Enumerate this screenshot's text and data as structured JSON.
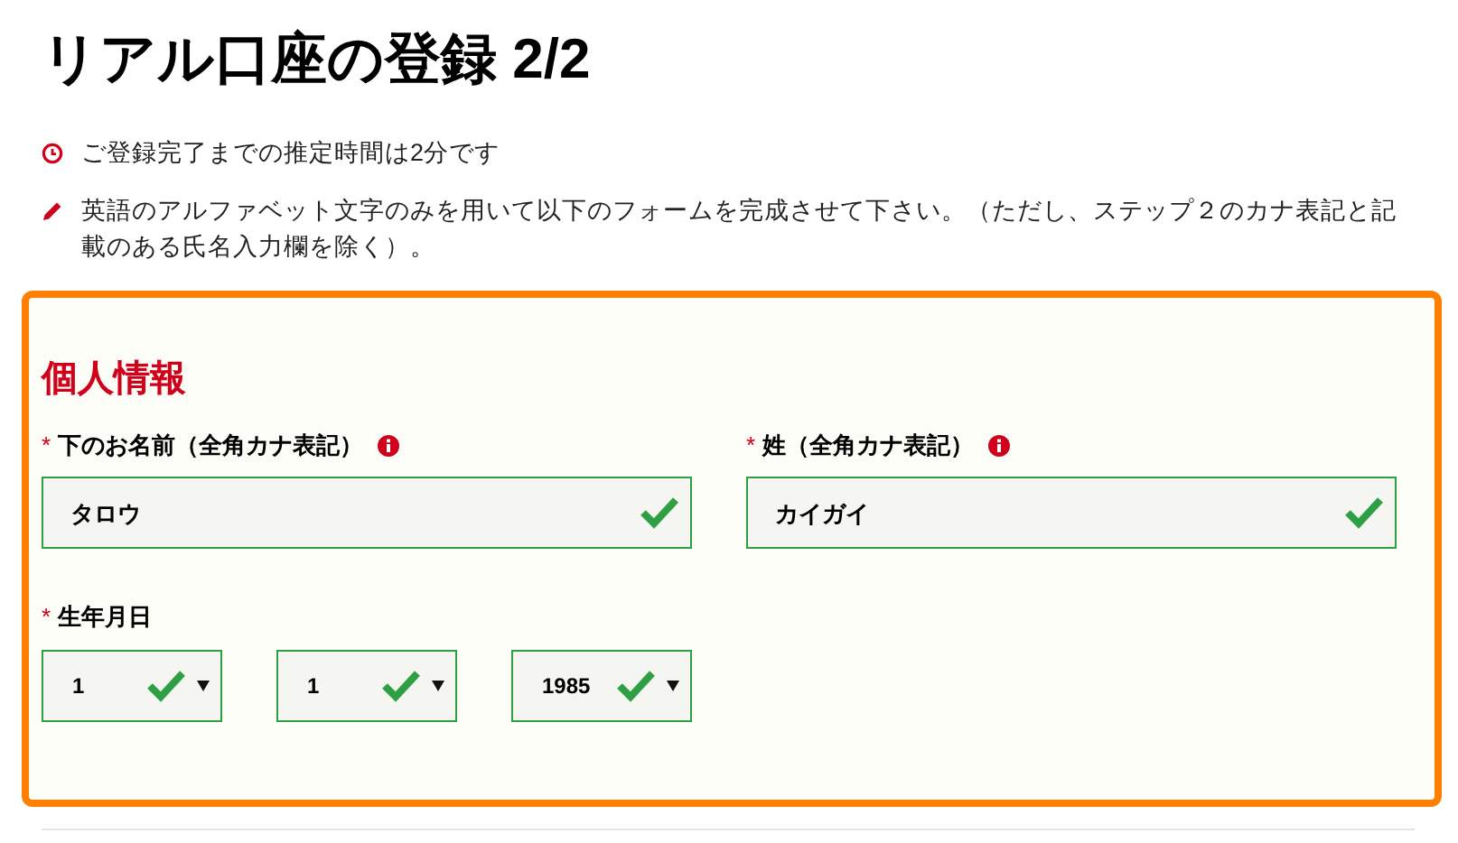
{
  "title": "リアル口座の登録 2/2",
  "notes": [
    {
      "kind": "clock",
      "text": "ご登録完了までの推定時間は2分です"
    },
    {
      "kind": "pencil",
      "text": "英語のアルファベット文字のみを用いて以下のフォームを完成させて下さい。（ただし、ステップ２のカナ表記と記載のある氏名入力欄を除く）。"
    }
  ],
  "section": {
    "heading": "個人情報",
    "name_fields": [
      {
        "label": "下のお名前（全角カナ表記）",
        "marker": "*",
        "info": true,
        "value": "タロウ",
        "valid": true
      },
      {
        "label": "姓（全角カナ表記）",
        "marker": "*",
        "info": true,
        "value": "カイガイ",
        "valid": true
      }
    ],
    "birth": {
      "label": "生年月日",
      "marker": "*",
      "selects": [
        {
          "value": "1",
          "valid": true
        },
        {
          "value": "1",
          "valid": true
        },
        {
          "value": "1985",
          "valid": true
        }
      ]
    }
  }
}
